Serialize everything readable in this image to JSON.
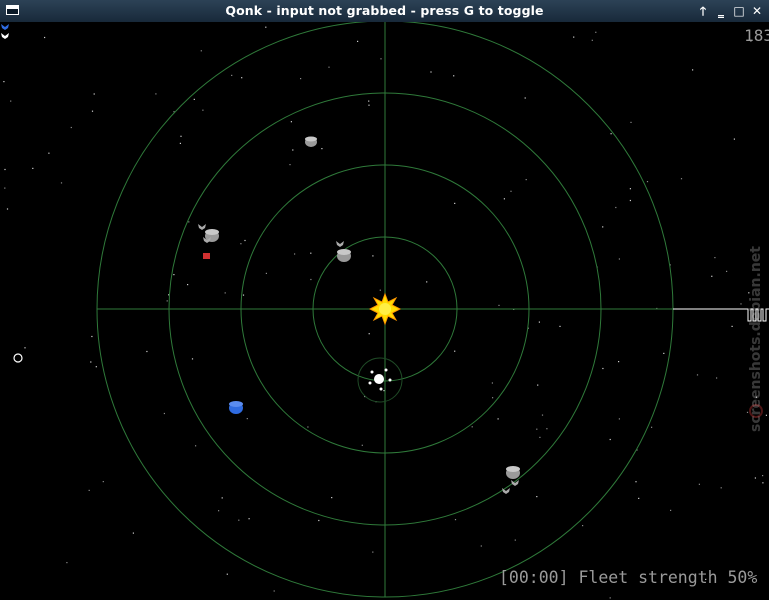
{
  "window": {
    "title": "Qonk - input not grabbed - press G to toggle",
    "controls": [
      {
        "name": "shade-button",
        "glyph": "🡑"
      },
      {
        "name": "minimize-button",
        "glyph": "‗"
      },
      {
        "name": "maximize-button",
        "glyph": "□"
      },
      {
        "name": "close-button",
        "glyph": "✕"
      }
    ]
  },
  "hud": {
    "counter": "183",
    "status": "[00:00] Fleet strength 50%"
  },
  "watermark": "screenshots.debian.net",
  "colors": {
    "background": "#000000",
    "orbit": "#2f7a3a",
    "sun": "#ffdd00",
    "player": "#ffffff",
    "enemy_blue": "#2f6be0",
    "enemy_red": "#d03030",
    "neutral": "#9a9a9a",
    "hud_text": "#9a9a9a"
  },
  "game": {
    "orbit_count": 4,
    "sun": {
      "icon": "sun-icon"
    },
    "planets": [
      {
        "name": "planet-top",
        "owner": "neutral"
      },
      {
        "name": "planet-center-left",
        "owner": "neutral"
      },
      {
        "name": "planet-left-upper",
        "owner": "neutral"
      },
      {
        "name": "planet-player-home",
        "owner": "player"
      },
      {
        "name": "planet-blue",
        "owner": "blue"
      },
      {
        "name": "planet-lower-right",
        "owner": "neutral"
      }
    ],
    "ships": [
      "neutral",
      "neutral",
      "red",
      "neutral",
      "neutral",
      "player",
      "player",
      "player",
      "player",
      "player"
    ]
  }
}
